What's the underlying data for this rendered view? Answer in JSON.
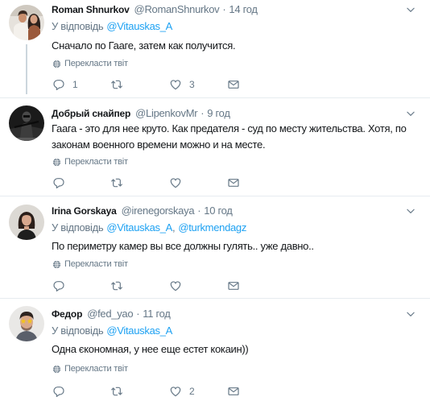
{
  "theme": {
    "accent": "#1da1f2",
    "text": "#14171a",
    "secondary": "#657786",
    "divider": "#e6ecf0",
    "thread_line": "#ccd6dd",
    "background": "#ffffff"
  },
  "meta_separator": "·",
  "icons": {
    "menu": "chevron-down-icon",
    "translate": "globe-icon",
    "reply": "reply-icon",
    "retweet": "retweet-icon",
    "like": "heart-icon",
    "message": "envelope-icon"
  },
  "tweets": [
    {
      "name": "Roman Shnurkov",
      "handle": "@RomanShnurkov",
      "time": "14 год",
      "reply_context": {
        "label": "У відповідь",
        "handles": [
          "@Vitauskas_A"
        ]
      },
      "text": "Сначало по Гааге, затем как получится.",
      "translate": "Перекласти твіт",
      "actions": {
        "reply": "1",
        "like": "3"
      }
    },
    {
      "name": "Добрый снайпер",
      "handle": "@LipenkovMr",
      "time": "9 год",
      "text": "Гаага - это для нее круто. Как предателя - суд по месту жительства. Хотя, по законам военного времени можно и на месте.",
      "translate": "Перекласти твіт"
    },
    {
      "name": "Irina Gorskaya",
      "handle": "@irenegorskaya",
      "time": "10 год",
      "reply_context": {
        "label": "У відповідь",
        "handles": [
          "@Vitauskas_A",
          "@turkmendagz"
        ],
        "separator": ","
      },
      "text": "По периметру камер вы все должны гулять.. уже давно..",
      "translate": "Перекласти твіт"
    },
    {
      "name": "Федор",
      "handle": "@fed_yao",
      "time": "11 год",
      "reply_context": {
        "label": "У відповідь",
        "handles": [
          "@Vitauskas_A"
        ]
      },
      "text": "Одна єкономная, у нее еще естет кокаин))",
      "translate": "Перекласти твіт",
      "actions": {
        "like": "2"
      }
    }
  ]
}
